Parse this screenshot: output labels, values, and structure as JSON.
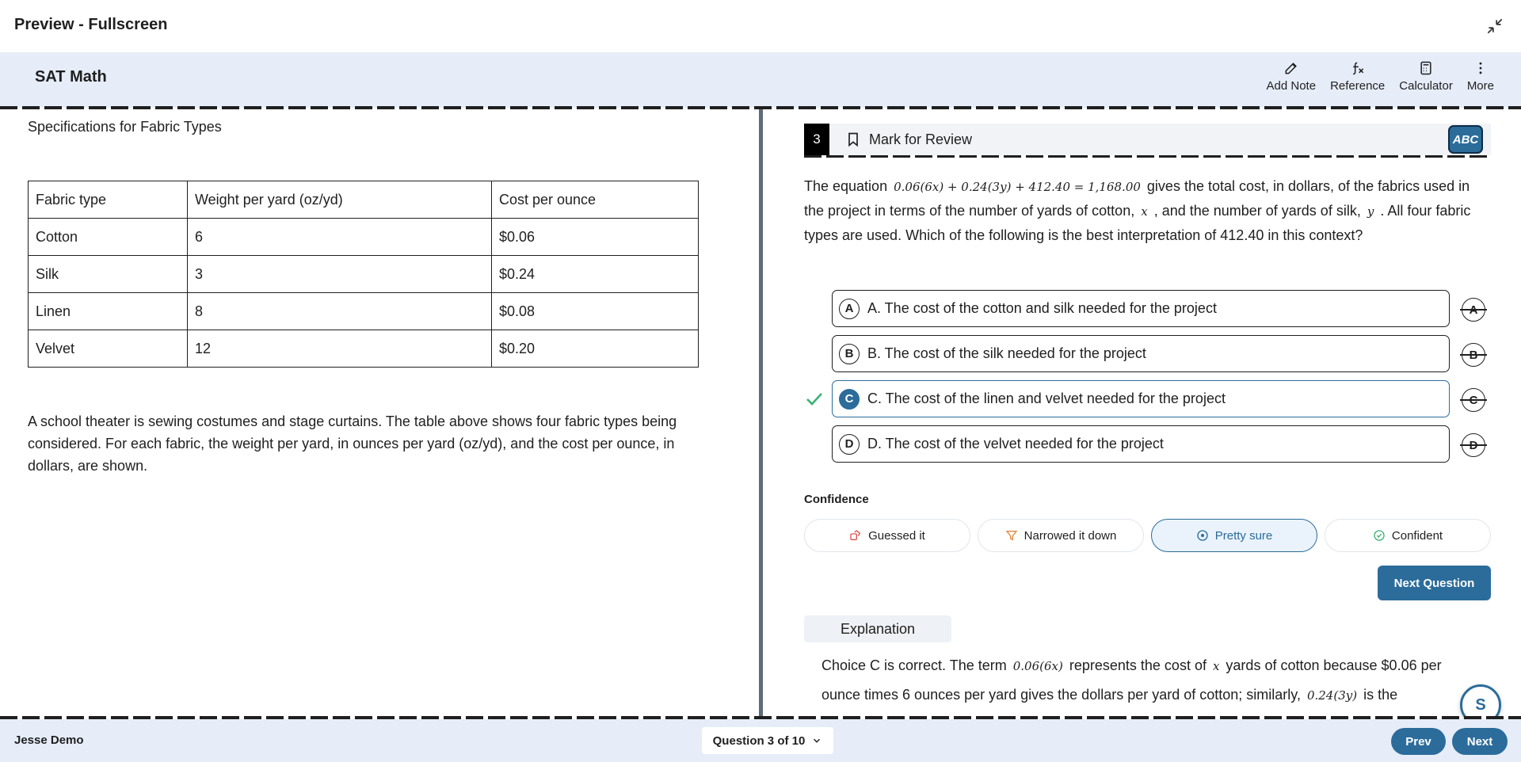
{
  "window": {
    "title": "Preview - Fullscreen",
    "collapse_icon": "collapse-arrows-icon"
  },
  "header": {
    "test_name": "SAT Math",
    "tools": [
      {
        "label": "Add Note",
        "icon": "pencil-icon"
      },
      {
        "label": "Reference",
        "icon": "function-icon"
      },
      {
        "label": "Calculator",
        "icon": "calculator-icon"
      },
      {
        "label": "More",
        "icon": "kebab-icon"
      }
    ]
  },
  "passage": {
    "table_title": "Specifications for Fabric Types",
    "table": {
      "headers": [
        "Fabric type",
        "Weight per yard (oz/yd)",
        "Cost per ounce"
      ],
      "rows": [
        [
          "Cotton",
          "6",
          "$0.06"
        ],
        [
          "Silk",
          "3",
          "$0.24"
        ],
        [
          "Linen",
          "8",
          "$0.08"
        ],
        [
          "Velvet",
          "12",
          "$0.20"
        ]
      ]
    },
    "text": "A school theater is sewing costumes and stage curtains. The table above shows four fabric types being considered. For each fabric, the weight per yard, in ounces per yard (oz/yd), and the cost per ounce, in dollars, are shown."
  },
  "question": {
    "number": "3",
    "mark_label": "Mark for Review",
    "abc_label": "ABC",
    "stem_1": "The equation",
    "equation": "0.06(6x) + 0.24(3y) + 412.40 = 1,168.00",
    "stem_2": "gives the total cost, in dollars, of the fabrics used in the project in terms of the number of yards of cotton,",
    "var_x": "x",
    "stem_3": ", and the number of yards of silk,",
    "var_y": "y",
    "stem_4": ". All four fabric types are used. Which of the following is the best interpretation of 412.40 in this context?",
    "choices": [
      {
        "letter": "A",
        "text": "A. The cost of the cotton and silk needed for the project"
      },
      {
        "letter": "B",
        "text": "B. The cost of the silk needed for the project"
      },
      {
        "letter": "C",
        "text": "C. The cost of the linen and velvet needed for the project"
      },
      {
        "letter": "D",
        "text": "D. The cost of the velvet needed for the project"
      }
    ],
    "selected": "C"
  },
  "confidence": {
    "label": "Confidence",
    "options": [
      {
        "label": "Guessed it",
        "icon": "dice-icon"
      },
      {
        "label": "Narrowed it down",
        "icon": "funnel-icon"
      },
      {
        "label": "Pretty sure",
        "icon": "target-icon"
      },
      {
        "label": "Confident",
        "icon": "check-circle-icon"
      }
    ],
    "selected": "Pretty sure"
  },
  "next_question_label": "Next Question",
  "explanation": {
    "tab_label": "Explanation",
    "text_1": "Choice C is correct. The term",
    "math_1": "0.06(6x)",
    "text_2": "represents the cost of",
    "math_2": "x",
    "text_3": "yards of cotton because $0.06 per ounce times 6 ounces per yard gives the dollars per yard of cotton; similarly,",
    "math_3": "0.24(3y)",
    "text_4": "is the"
  },
  "assistant_button": "S",
  "footer": {
    "user": "Jesse Demo",
    "question_nav": "Question 3 of 10",
    "prev": "Prev",
    "next": "Next"
  },
  "colors": {
    "accent": "#2b6c9b",
    "header_bg": "#e6edf8",
    "correct": "#3bb273"
  }
}
